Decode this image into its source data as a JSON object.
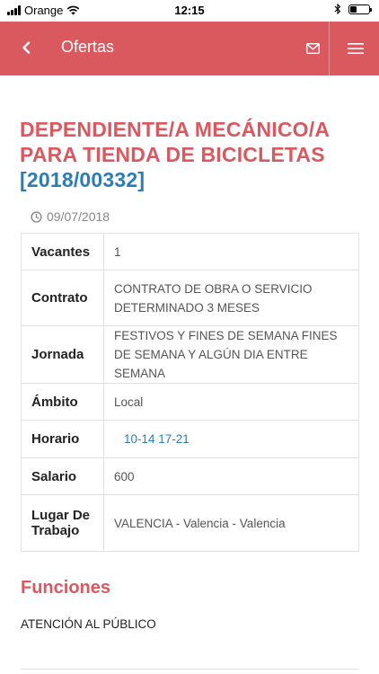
{
  "status_bar": {
    "carrier": "Orange",
    "time": "12:15",
    "battery_level": 0.35
  },
  "header": {
    "title": "Ofertas",
    "back_icon": "chevron-left-icon",
    "mail_icon": "mail-icon",
    "menu_icon": "hamburger-menu-icon",
    "background": "#d9595f"
  },
  "job": {
    "title": "DEPENDIENTE/A MECÁNICO/A PARA TIENDA DE BICICLETAS ",
    "ref_open": "[",
    "ref": "2018/00332",
    "ref_close": "]",
    "date": "09/07/2018"
  },
  "details": [
    {
      "label": "Vacantes",
      "value": "1"
    },
    {
      "label": "Contrato",
      "value": "CONTRATO DE OBRA O SERVICIO DETERMINADO 3 MESES"
    },
    {
      "label": "Jornada",
      "value": "FESTIVOS Y FINES DE SEMANA FINES DE SEMANA Y ALGÚN DIA ENTRE SEMANA"
    },
    {
      "label": "Ámbito",
      "value": "Local"
    },
    {
      "label": "Horario",
      "value": "10-14 17-21"
    },
    {
      "label": "Salario",
      "value": "600"
    },
    {
      "label": "Lugar De Trabajo",
      "value": "VALENCIA - Valencia - Valencia"
    }
  ],
  "functions": {
    "title": "Funciones",
    "text": "ATENCIÓN AL PÚBLICO"
  },
  "colors": {
    "accent": "#d9595f",
    "link": "#2d7db5"
  }
}
